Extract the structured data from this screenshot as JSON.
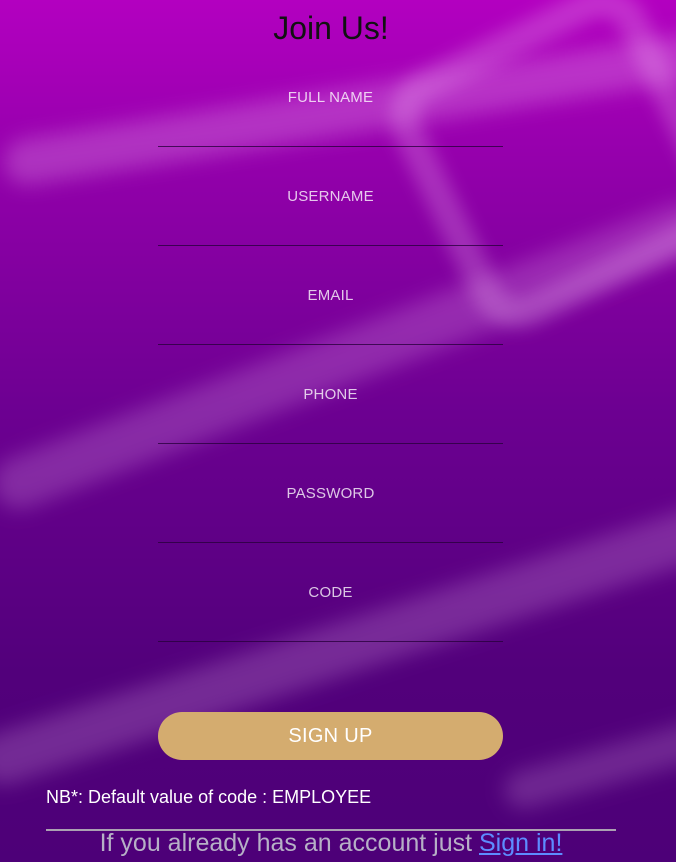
{
  "page": {
    "title": "Join Us!"
  },
  "form": {
    "fields": [
      {
        "label": "FULL NAME",
        "value": ""
      },
      {
        "label": "USERNAME",
        "value": ""
      },
      {
        "label": "EMAIL",
        "value": ""
      },
      {
        "label": "PHONE",
        "value": ""
      },
      {
        "label": "PASSWORD",
        "value": ""
      },
      {
        "label": "CODE",
        "value": ""
      }
    ],
    "submit_label": "SIGN UP"
  },
  "note": {
    "text": "NB*: Default value of code : EMPLOYEE"
  },
  "footer": {
    "text": "If you already has an account just ",
    "link_text": "Sign in!"
  },
  "colors": {
    "background_top": "#b300c0",
    "background_bottom": "#4d0078",
    "button": "#d4ac6f",
    "link": "#5d8cff"
  }
}
